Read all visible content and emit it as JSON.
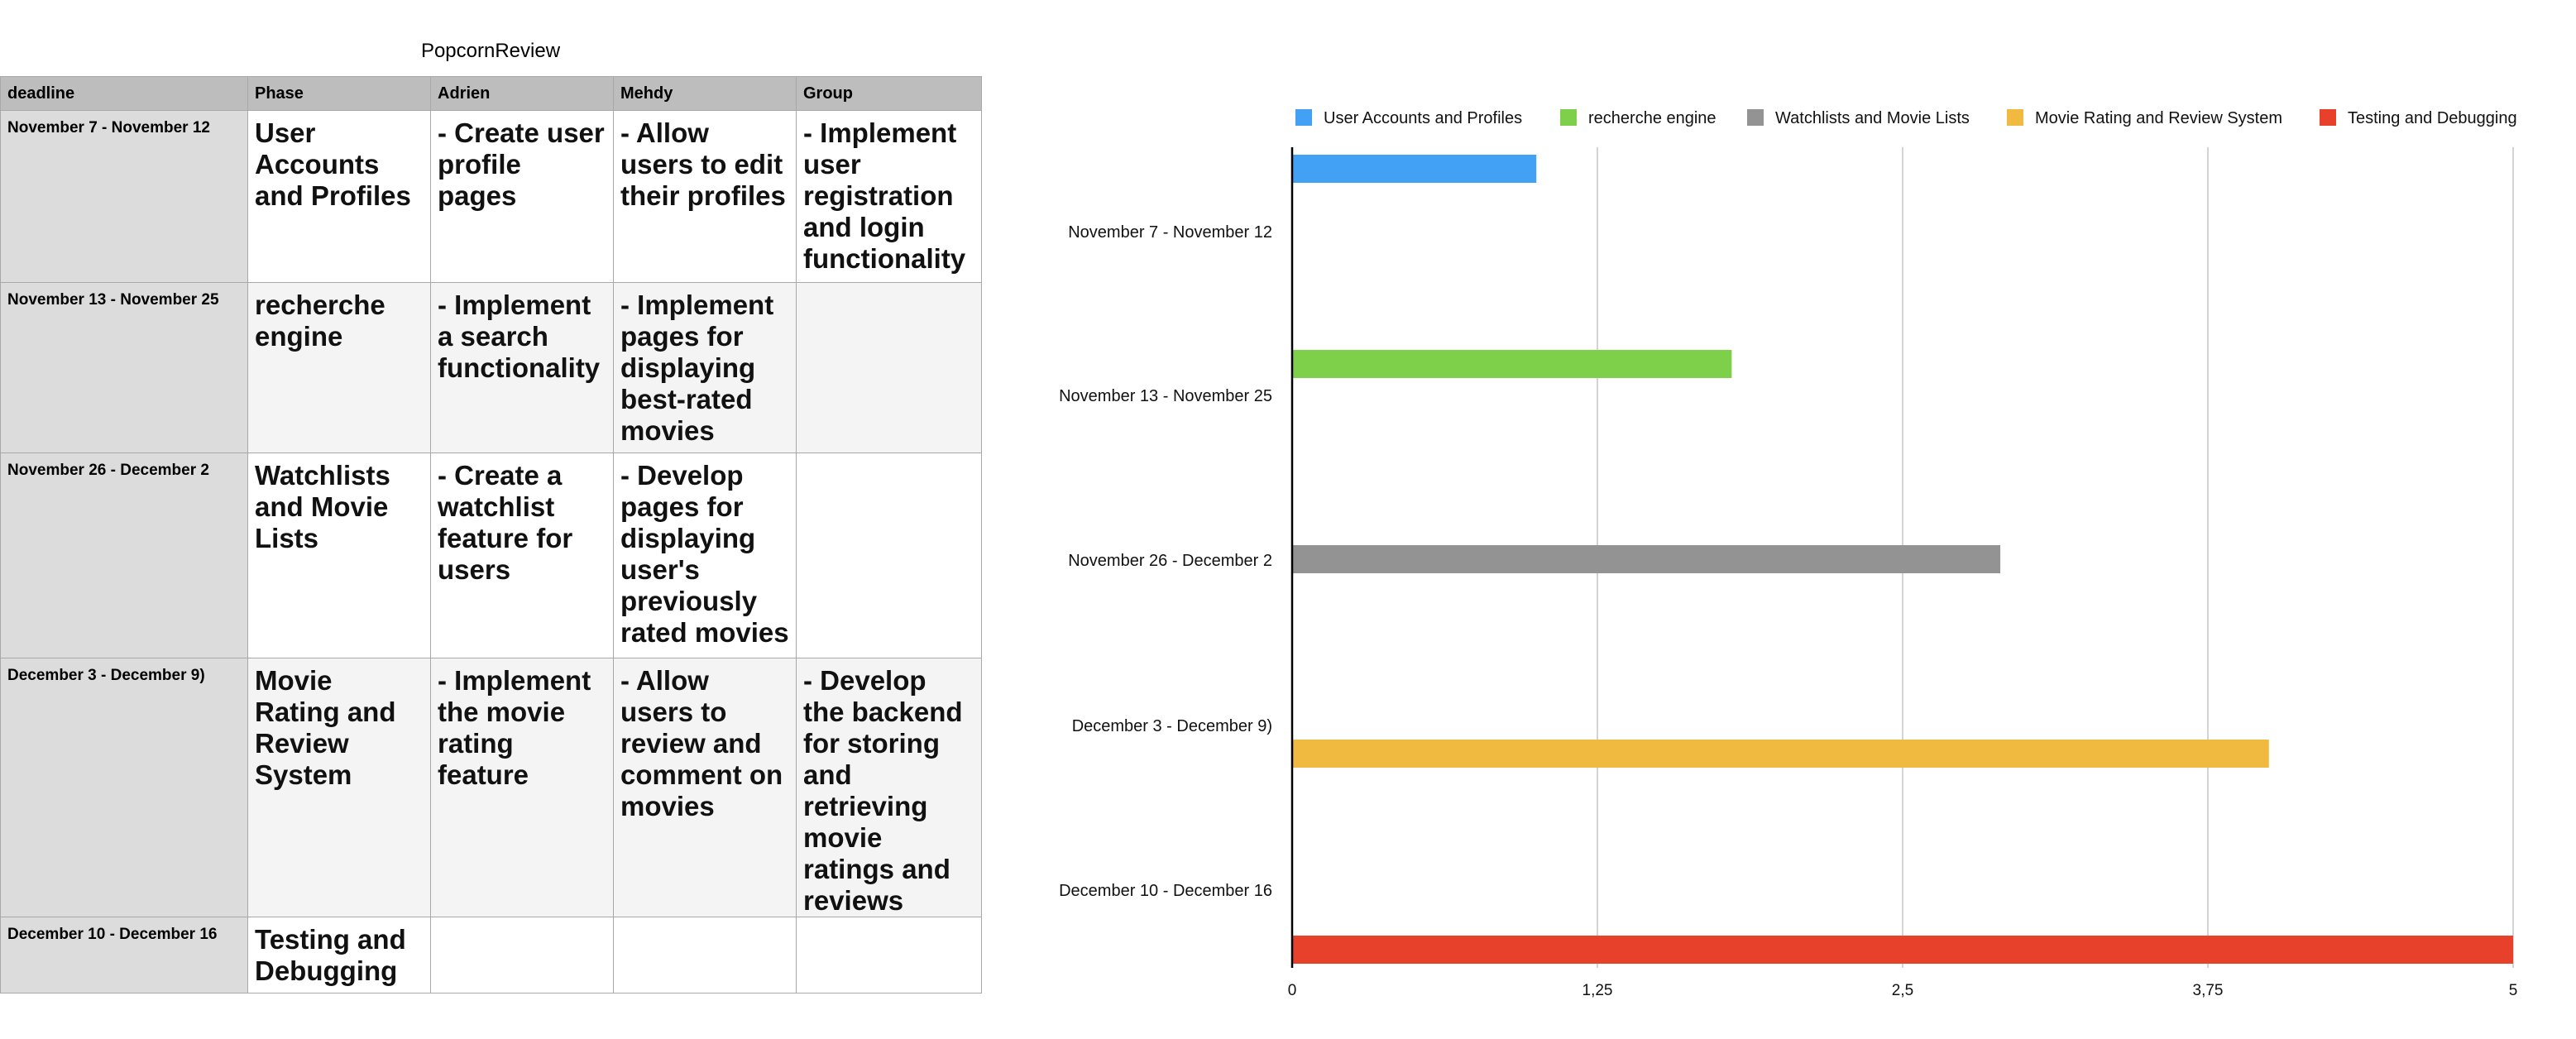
{
  "sheet": {
    "title": "PopcornReview",
    "headers": [
      "deadline",
      "Phase",
      "Adrien",
      "Mehdy",
      "Group"
    ],
    "rows": [
      {
        "deadline": "November 7 - November 12",
        "phase": "User Accounts and Profiles",
        "adrien": "- Create user profile pages",
        "mehdy": "- Allow users to edit their profiles",
        "group": "- Implement user registration and login functionality"
      },
      {
        "deadline": "November 13 - November 25",
        "phase": "recherche engine",
        "adrien": "- Implement a search functionality",
        "mehdy": "- Implement pages for displaying best-rated movies",
        "group": ""
      },
      {
        "deadline": "November 26 - December 2",
        "phase": "Watchlists and Movie Lists",
        "adrien": "- Create a watchlist feature for users",
        "mehdy": "- Develop pages for displaying user's previously rated movies",
        "group": ""
      },
      {
        "deadline": "December 3 - December 9)",
        "phase": "Movie Rating and Review System",
        "adrien": "- Implement the movie rating feature",
        "mehdy": "- Allow users to review and comment on movies",
        "group": "- Develop the backend for storing and retrieving movie ratings and reviews"
      },
      {
        "deadline": "December 10 - December 16",
        "phase": "Testing and Debugging",
        "adrien": "",
        "mehdy": "",
        "group": ""
      }
    ]
  },
  "chart_data": {
    "type": "bar",
    "orientation": "horizontal",
    "categories": [
      "November 7 - November 12",
      "November 13 - November 25",
      "November 26 - December 2",
      "December 3 - December 9)",
      "December 10 - December 16"
    ],
    "series": [
      {
        "name": "User Accounts and Profiles",
        "color": "#42a0f5",
        "values": [
          1,
          null,
          null,
          null,
          null
        ]
      },
      {
        "name": "recherche engine",
        "color": "#7ed04b",
        "values": [
          null,
          1.8,
          null,
          null,
          null
        ]
      },
      {
        "name": "Watchlists and Movie Lists",
        "color": "#939393",
        "values": [
          null,
          null,
          2.9,
          null,
          null
        ]
      },
      {
        "name": "Movie Rating and Review System",
        "color": "#f0ba41",
        "values": [
          null,
          null,
          null,
          4,
          null
        ]
      },
      {
        "name": "Testing and Debugging",
        "color": "#e8412b",
        "values": [
          null,
          null,
          null,
          null,
          5
        ]
      }
    ],
    "xlim": [
      0,
      5
    ],
    "xticks": [
      "0",
      "1,25",
      "2,5",
      "3,75",
      "5"
    ],
    "grid": "vertical",
    "legend": "top"
  }
}
